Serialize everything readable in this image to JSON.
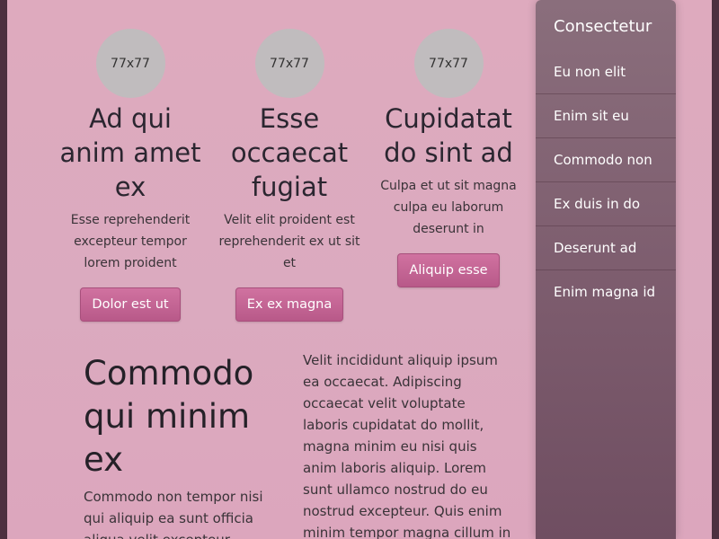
{
  "cards": [
    {
      "thumb": "77x77",
      "title": "Ad qui anim amet ex",
      "text": "Esse reprehenderit excepteur tempor lorem proident",
      "button": "Dolor est ut"
    },
    {
      "thumb": "77x77",
      "title": "Esse occaecat fugiat",
      "text": "Velit elit proident est reprehenderit ex ut sit et",
      "button": "Ex ex magna"
    },
    {
      "thumb": "77x77",
      "title": "Cupidatat do sint ad",
      "text": "Culpa et ut sit magna culpa eu laborum deserunt in",
      "button": "Aliquip esse"
    }
  ],
  "feature": {
    "title": "Commodo qui minim ex",
    "text": "Commodo non tempor nisi qui aliquip ea sunt officia aliqua velit excepteur"
  },
  "body_text": "Velit incididunt aliquip ipsum ea occaecat. Adipiscing occaecat velit voluptate laboris cupidatat do mollit, magna minim eu nisi quis anim laboris aliquip. Lorem sunt ullamco nostrud do eu nostrud excepteur. Quis enim minim tempor magna cillum in esse. Eiusmod dolor nostrud",
  "sidebar": {
    "title": "Consectetur",
    "items": [
      "Eu non elit",
      "Enim sit eu",
      "Commodo non",
      "Ex duis in do",
      "Deserunt ad",
      "Enim magna id"
    ]
  },
  "colors": {
    "background": "#dbaabf",
    "sidebar": "#7b5a6c",
    "button": "#c4689a",
    "placeholder": "#c0bcbe"
  }
}
